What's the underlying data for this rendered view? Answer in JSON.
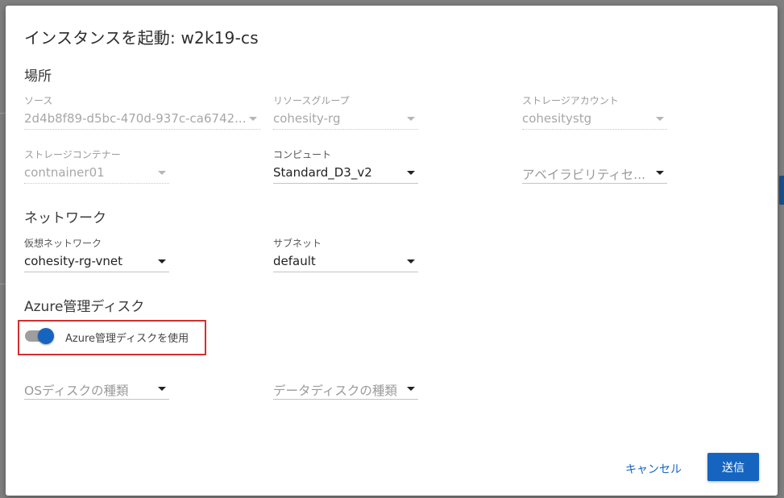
{
  "dialog": {
    "title": "インスタンスを起動: w2k19-cs"
  },
  "sections": {
    "location": "場所",
    "network": "ネットワーク",
    "disk": "Azure管理ディスク"
  },
  "fields": {
    "source": {
      "label": "ソース",
      "value": "2d4b8f89-d5bc-470d-937c-ca6742..."
    },
    "resource_group": {
      "label": "リソースグループ",
      "value": "cohesity-rg"
    },
    "storage_account": {
      "label": "ストレージアカウント",
      "value": "cohesitystg"
    },
    "storage_container": {
      "label": "ストレージコンテナー",
      "value": "contnainer01"
    },
    "compute": {
      "label": "コンピュート",
      "value": "Standard_D3_v2"
    },
    "availability_set": {
      "placeholder": "アベイラビリティセ..."
    },
    "virtual_network": {
      "label": "仮想ネットワーク",
      "value": "cohesity-rg-vnet"
    },
    "subnet": {
      "label": "サブネット",
      "value": "default"
    },
    "os_disk_type": {
      "placeholder": "OSディスクの種類"
    },
    "data_disk_type": {
      "placeholder": "データディスクの種類"
    }
  },
  "toggle": {
    "label": "Azure管理ディスクを使用",
    "checked": true,
    "accent": "#1565c0",
    "highlight_color": "#d32f2f"
  },
  "actions": {
    "cancel": "キャンセル",
    "submit": "送信"
  }
}
